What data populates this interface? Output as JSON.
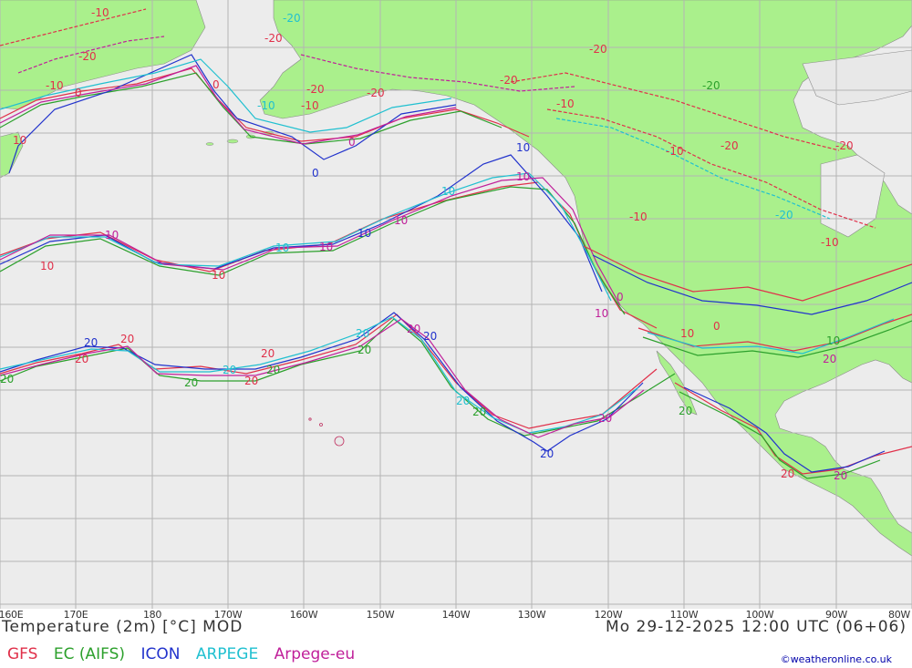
{
  "map": {
    "colors": {
      "ocean": "#ececec",
      "land": "#aaf08c",
      "grid": "#b4b4b4",
      "gfs": "#e0304a",
      "ec": "#2ca02c",
      "icon": "#2233cc",
      "arpege": "#20c0d0",
      "arpege_eu": "#c0209a"
    },
    "labels": {
      "minus20": "-20",
      "minus10": "-10",
      "zero": "0",
      "plus10": "10",
      "plus20": "20"
    }
  },
  "footer": {
    "lon_labels": [
      "160E",
      "170E",
      "180",
      "170W",
      "160W",
      "150W",
      "140W",
      "130W",
      "120W",
      "110W",
      "100W",
      "90W",
      "80W"
    ],
    "title": "Temperature (2m) [°C] MOD",
    "datetime": "Mo 29-12-2025 12:00 UTC (06+06)",
    "legend": [
      {
        "name": "GFS",
        "color": "#e0304a"
      },
      {
        "name": "EC (AIFS)",
        "color": "#2ca02c"
      },
      {
        "name": "ICON",
        "color": "#2233cc"
      },
      {
        "name": "ARPEGE",
        "color": "#20c0d0"
      },
      {
        "name": "Arpege-eu",
        "color": "#c0209a"
      }
    ],
    "credit": "©weatheronline.co.uk"
  }
}
